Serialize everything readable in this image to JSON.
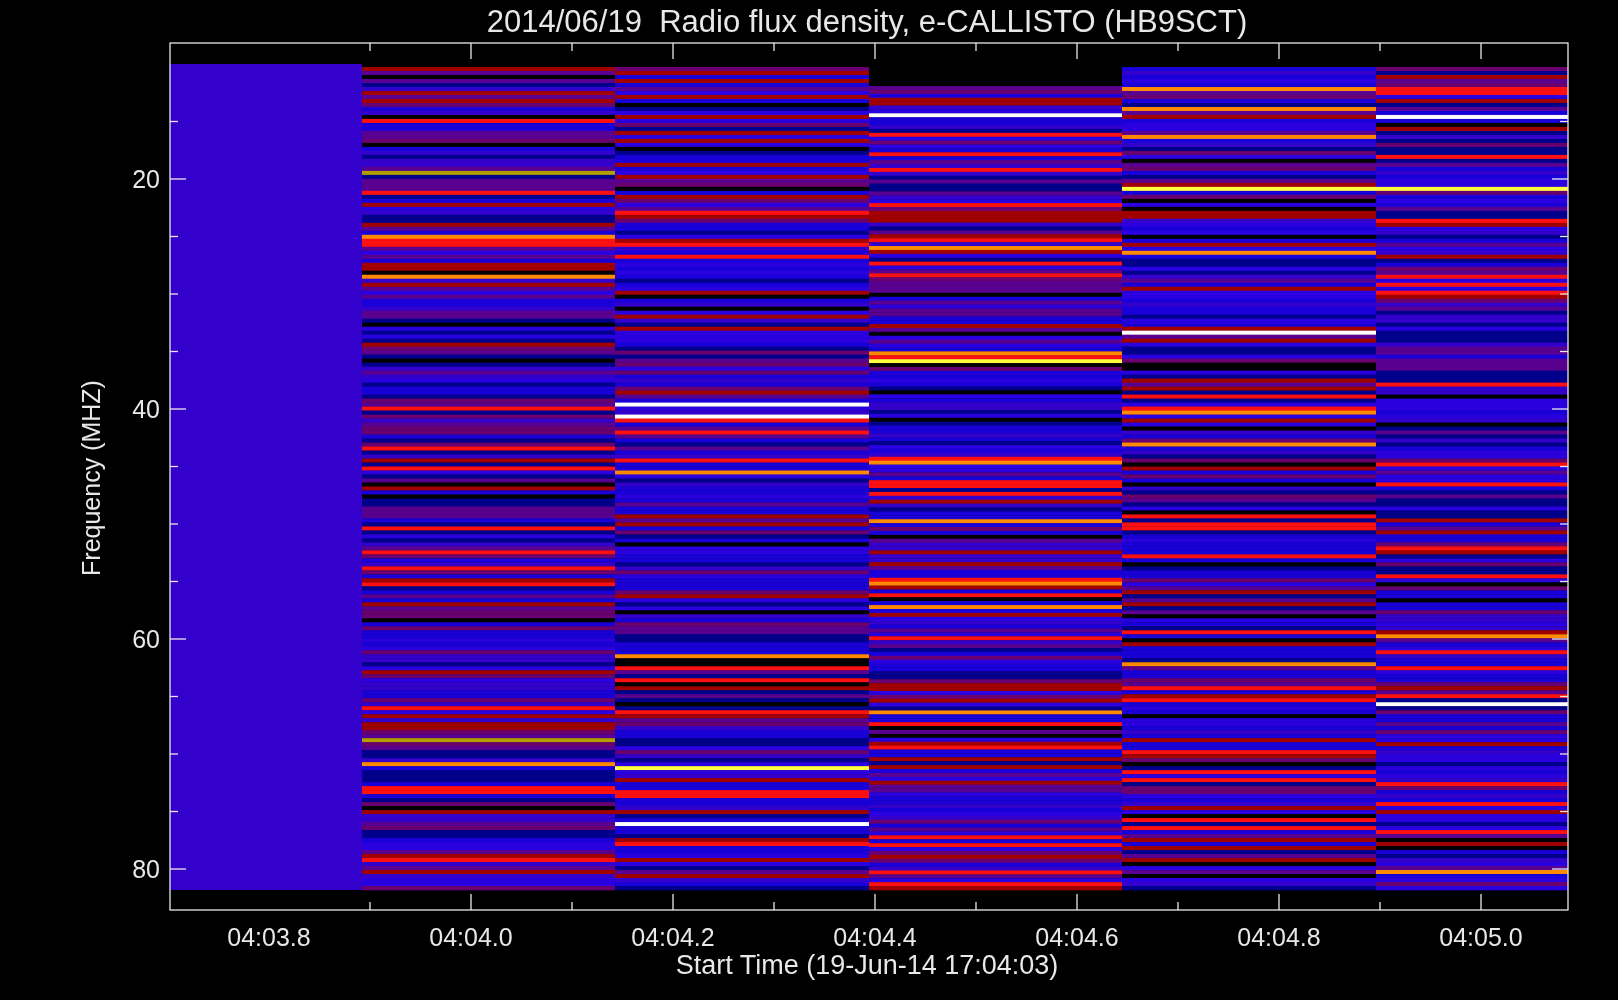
{
  "title": "2014/06/19  Radio flux density, e-CALLISTO (HB9SCT)",
  "y_axis": {
    "label": "Frequency (MHZ)",
    "tick_labels": [
      "20",
      "40",
      "60",
      "80"
    ]
  },
  "x_axis": {
    "label": "Start Time (19-Jun-14 17:04:03)",
    "tick_labels": [
      "04:03.8",
      "04:04.0",
      "04:04.2",
      "04:04.4",
      "04:04.6",
      "04:04.8",
      "04:05.0"
    ]
  }
}
